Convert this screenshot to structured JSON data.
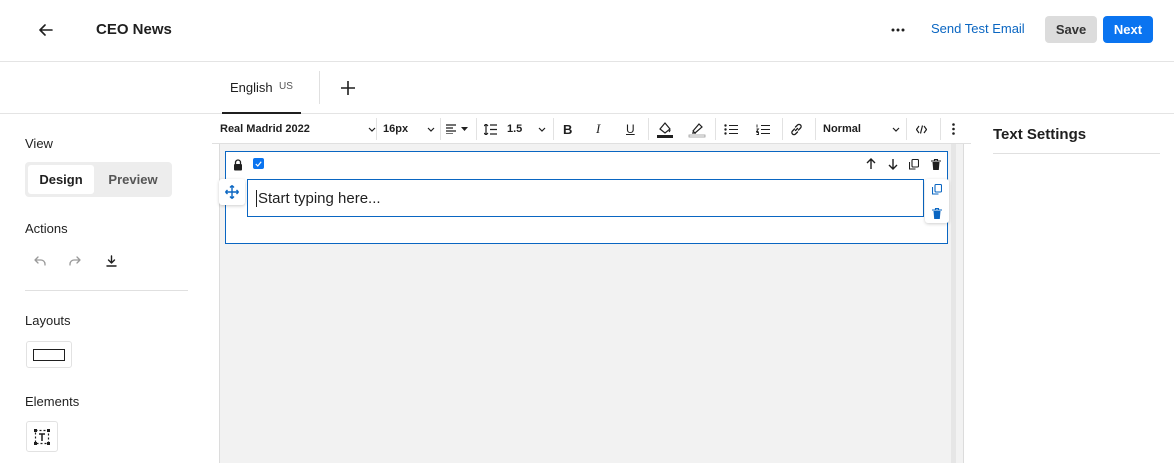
{
  "header": {
    "title": "CEO News",
    "send_test_label": "Send Test Email",
    "save_label": "Save",
    "next_label": "Next"
  },
  "languages": {
    "tabs": [
      {
        "name": "English",
        "code": "US",
        "selected": true
      }
    ]
  },
  "left_panel": {
    "view_title": "View",
    "view_options": [
      "Design",
      "Preview"
    ],
    "view_selected": "Design",
    "actions_title": "Actions",
    "layouts_title": "Layouts",
    "elements_title": "Elements"
  },
  "toolbar": {
    "font_family": "Real Madrid 2022",
    "font_size": "16px",
    "line_height": "1.5",
    "paragraph_style": "Normal"
  },
  "editor": {
    "placeholder": "Start typing here..."
  },
  "right_panel": {
    "title": "Text Settings"
  },
  "colors": {
    "accent": "#0a74f0",
    "link": "#0a66c2",
    "canvas_bg": "#f2f2f2"
  }
}
